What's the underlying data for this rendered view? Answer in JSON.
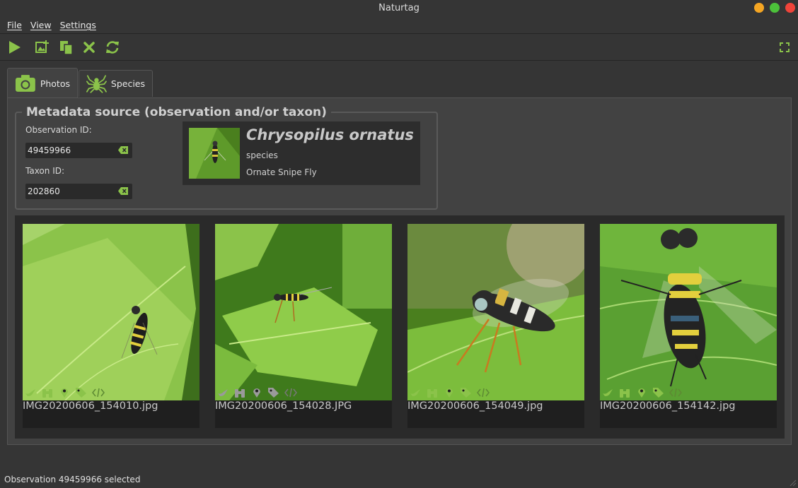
{
  "window": {
    "title": "Naturtag",
    "buttons": [
      "minimize",
      "maximize",
      "close"
    ]
  },
  "menu": {
    "items": [
      {
        "label": "File"
      },
      {
        "label": "View"
      },
      {
        "label": "Settings"
      }
    ]
  },
  "toolbar": {
    "icons": [
      "run-icon",
      "add-image-icon",
      "paste-icon",
      "clear-icon",
      "refresh-icon",
      "fullscreen-icon"
    ]
  },
  "tabs": [
    {
      "label": "Photos",
      "icon": "camera-icon",
      "active": true
    },
    {
      "label": "Species",
      "icon": "spider-icon",
      "active": false
    }
  ],
  "metadata": {
    "legend": "Metadata source (observation and/or taxon)",
    "observation_label": "Observation ID:",
    "observation_value": "49459966",
    "taxon_label": "Taxon ID:",
    "taxon_value": "202860"
  },
  "taxon": {
    "name": "Chrysopilus ornatus",
    "rank": "species",
    "common_name": "Ornate Snipe Fly"
  },
  "gallery": {
    "photos": [
      {
        "filename": "IMG20200606_154010.jpg"
      },
      {
        "filename": "IMG20200606_154028.JPG"
      },
      {
        "filename": "IMG20200606_154049.jpg"
      },
      {
        "filename": "IMG20200606_154142.jpg"
      }
    ],
    "photo_icons": [
      "bird-icon",
      "binoculars-icon",
      "location-icon",
      "tags-icon",
      "code-icon"
    ]
  },
  "status": {
    "text": "Observation 49459966 selected"
  },
  "colors": {
    "accent": "#8bc34a",
    "background": "#353535",
    "panel": "#424242",
    "gallery": "#2a2a2a"
  }
}
